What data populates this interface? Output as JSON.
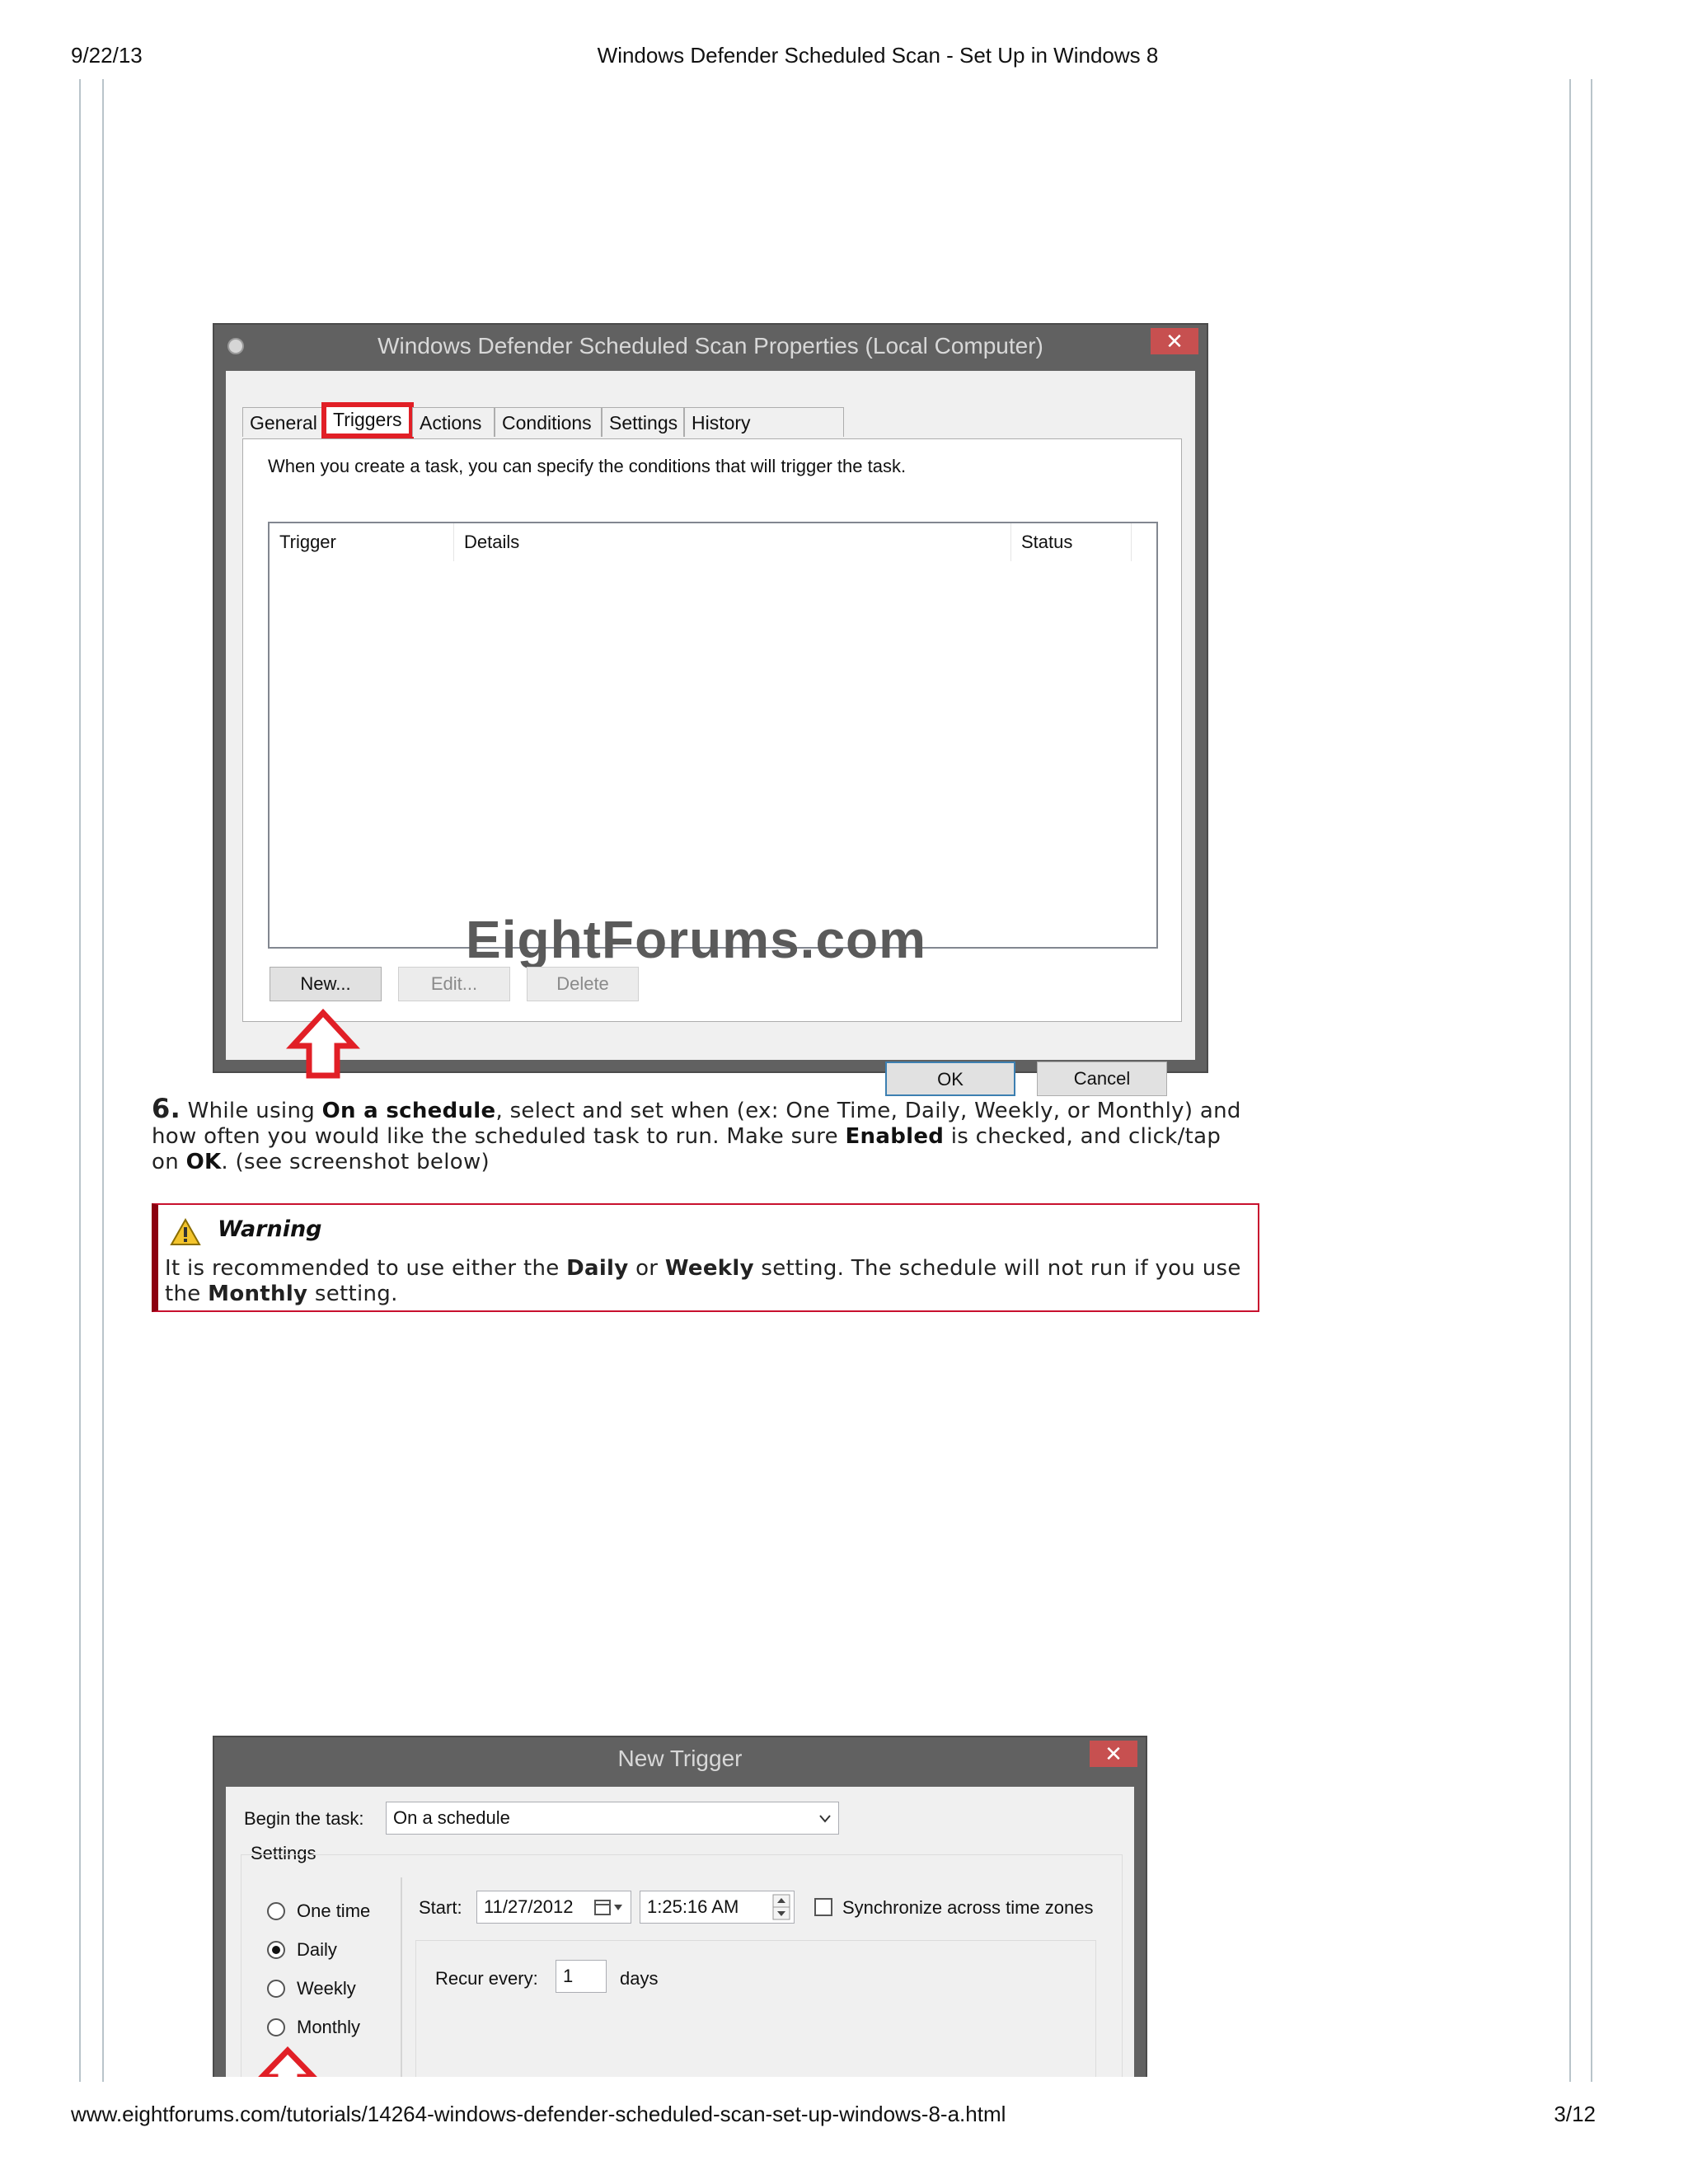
{
  "header": {
    "date": "9/22/13",
    "title": "Windows Defender Scheduled Scan - Set Up in Windows 8"
  },
  "footer": {
    "url": "www.eightforums.com/tutorials/14264-windows-defender-scheduled-scan-set-up-windows-8-a.html",
    "page": "3/12"
  },
  "window1": {
    "title": "Windows Defender Scheduled Scan Properties (Local Computer)",
    "close_glyph": "✕",
    "tabs": [
      "General",
      "Triggers",
      "Actions",
      "Conditions",
      "Settings",
      "History (disabled)"
    ],
    "active_tab": "Triggers",
    "description": "When you create a task, you can specify the conditions that will trigger the task.",
    "columns": [
      "Trigger",
      "Details",
      "Status"
    ],
    "watermark": "EightForums.com",
    "buttons": {
      "new": "New...",
      "edit": "Edit...",
      "delete": "Delete",
      "ok": "OK",
      "cancel": "Cancel"
    }
  },
  "step6": {
    "number": "6.",
    "t1": " While using ",
    "b1": "On a schedule",
    "t2": ", select and set when (ex: One Time, Daily, Weekly, or Monthly) and how often you would like the scheduled task to run. Make sure ",
    "b2": "Enabled",
    "t3": " is checked, and click/tap on ",
    "b3": "OK",
    "t4": ". (see screenshot below)"
  },
  "warning": {
    "title": "Warning",
    "t1": "It is recommended to use either the ",
    "b1": "Daily",
    "t2": " or ",
    "b2": "Weekly",
    "t3": " setting. The schedule will not run if you use the ",
    "b3": "Monthly",
    "t4": " setting."
  },
  "window2": {
    "title": "New Trigger",
    "close_glyph": "✕",
    "begin_label": "Begin the task:",
    "begin_value": "On a schedule",
    "settings_label": "Settings",
    "options": [
      "One time",
      "Daily",
      "Weekly",
      "Monthly"
    ],
    "selected_option": "Daily",
    "start_label": "Start:",
    "start_date": "11/27/2012",
    "start_time": "1:25:16 AM",
    "sync_label": "Synchronize across time zones",
    "recur_label": "Recur every:",
    "recur_value": "1",
    "recur_unit": "days"
  },
  "colors": {
    "highlight": "#e11f26",
    "warning_border": "#c8102e"
  }
}
